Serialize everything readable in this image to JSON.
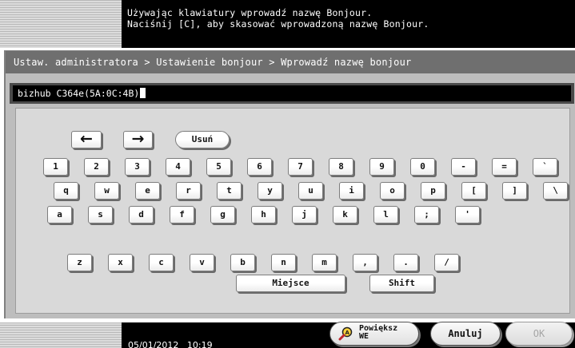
{
  "message": {
    "line1": "Używając klawiatury wprowadź nazwę Bonjour.",
    "line2": "Naciśnij [C], aby skasować wprowadzoną nazwę Bonjour."
  },
  "breadcrumb": "Ustaw. administratora > Ustawienie bonjour > Wprowadź nazwę bonjour",
  "input": {
    "value": "bizhub C364e(5A:0C:4B)"
  },
  "keyboard": {
    "arrow_left": "←",
    "arrow_right": "→",
    "delete_label": "Usuń",
    "row1": [
      "1",
      "2",
      "3",
      "4",
      "5",
      "6",
      "7",
      "8",
      "9",
      "0",
      "-",
      "=",
      "`"
    ],
    "row2": [
      "q",
      "w",
      "e",
      "r",
      "t",
      "y",
      "u",
      "i",
      "o",
      "p",
      "[",
      "]",
      "\\"
    ],
    "row3": [
      "a",
      "s",
      "d",
      "f",
      "g",
      "h",
      "j",
      "k",
      "l",
      ";",
      "'"
    ],
    "row4": [
      "z",
      "x",
      "c",
      "v",
      "b",
      "n",
      "m",
      ",",
      ".",
      "/"
    ],
    "space_label": "Miejsce",
    "shift_label": "Shift"
  },
  "footer": {
    "datetime": "05/01/2012   10:19",
    "zoom_label_top": "Powiększ",
    "zoom_label_bottom": "WE",
    "cancel_label": "Anuluj",
    "ok_label": "OK"
  },
  "icons": {
    "zoom": "magnifier-icon",
    "arrows": [
      "arrow-left-icon",
      "arrow-right-icon"
    ]
  }
}
